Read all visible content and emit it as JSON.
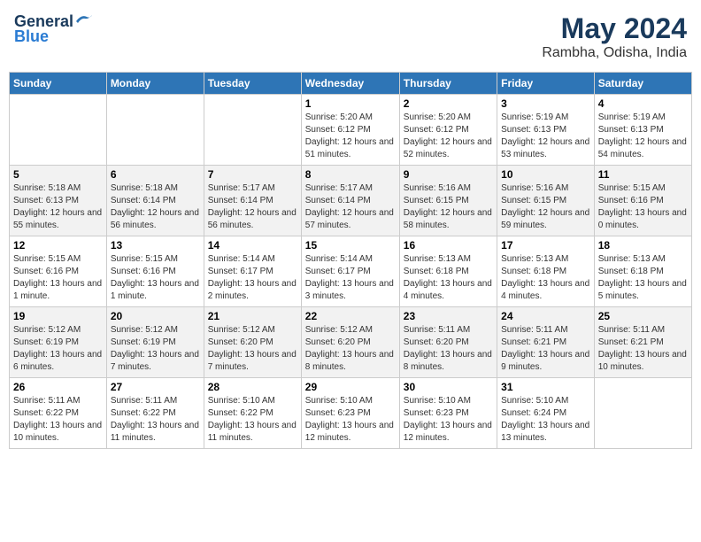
{
  "header": {
    "logo_general": "General",
    "logo_blue": "Blue",
    "month": "May 2024",
    "location": "Rambha, Odisha, India"
  },
  "days_of_week": [
    "Sunday",
    "Monday",
    "Tuesday",
    "Wednesday",
    "Thursday",
    "Friday",
    "Saturday"
  ],
  "weeks": [
    [
      {
        "day": "",
        "sunrise": "",
        "sunset": "",
        "daylight": ""
      },
      {
        "day": "",
        "sunrise": "",
        "sunset": "",
        "daylight": ""
      },
      {
        "day": "",
        "sunrise": "",
        "sunset": "",
        "daylight": ""
      },
      {
        "day": "1",
        "sunrise": "5:20 AM",
        "sunset": "6:12 PM",
        "daylight": "12 hours and 51 minutes."
      },
      {
        "day": "2",
        "sunrise": "5:20 AM",
        "sunset": "6:12 PM",
        "daylight": "12 hours and 52 minutes."
      },
      {
        "day": "3",
        "sunrise": "5:19 AM",
        "sunset": "6:13 PM",
        "daylight": "12 hours and 53 minutes."
      },
      {
        "day": "4",
        "sunrise": "5:19 AM",
        "sunset": "6:13 PM",
        "daylight": "12 hours and 54 minutes."
      }
    ],
    [
      {
        "day": "5",
        "sunrise": "5:18 AM",
        "sunset": "6:13 PM",
        "daylight": "12 hours and 55 minutes."
      },
      {
        "day": "6",
        "sunrise": "5:18 AM",
        "sunset": "6:14 PM",
        "daylight": "12 hours and 56 minutes."
      },
      {
        "day": "7",
        "sunrise": "5:17 AM",
        "sunset": "6:14 PM",
        "daylight": "12 hours and 56 minutes."
      },
      {
        "day": "8",
        "sunrise": "5:17 AM",
        "sunset": "6:14 PM",
        "daylight": "12 hours and 57 minutes."
      },
      {
        "day": "9",
        "sunrise": "5:16 AM",
        "sunset": "6:15 PM",
        "daylight": "12 hours and 58 minutes."
      },
      {
        "day": "10",
        "sunrise": "5:16 AM",
        "sunset": "6:15 PM",
        "daylight": "12 hours and 59 minutes."
      },
      {
        "day": "11",
        "sunrise": "5:15 AM",
        "sunset": "6:16 PM",
        "daylight": "13 hours and 0 minutes."
      }
    ],
    [
      {
        "day": "12",
        "sunrise": "5:15 AM",
        "sunset": "6:16 PM",
        "daylight": "13 hours and 1 minute."
      },
      {
        "day": "13",
        "sunrise": "5:15 AM",
        "sunset": "6:16 PM",
        "daylight": "13 hours and 1 minute."
      },
      {
        "day": "14",
        "sunrise": "5:14 AM",
        "sunset": "6:17 PM",
        "daylight": "13 hours and 2 minutes."
      },
      {
        "day": "15",
        "sunrise": "5:14 AM",
        "sunset": "6:17 PM",
        "daylight": "13 hours and 3 minutes."
      },
      {
        "day": "16",
        "sunrise": "5:13 AM",
        "sunset": "6:18 PM",
        "daylight": "13 hours and 4 minutes."
      },
      {
        "day": "17",
        "sunrise": "5:13 AM",
        "sunset": "6:18 PM",
        "daylight": "13 hours and 4 minutes."
      },
      {
        "day": "18",
        "sunrise": "5:13 AM",
        "sunset": "6:18 PM",
        "daylight": "13 hours and 5 minutes."
      }
    ],
    [
      {
        "day": "19",
        "sunrise": "5:12 AM",
        "sunset": "6:19 PM",
        "daylight": "13 hours and 6 minutes."
      },
      {
        "day": "20",
        "sunrise": "5:12 AM",
        "sunset": "6:19 PM",
        "daylight": "13 hours and 7 minutes."
      },
      {
        "day": "21",
        "sunrise": "5:12 AM",
        "sunset": "6:20 PM",
        "daylight": "13 hours and 7 minutes."
      },
      {
        "day": "22",
        "sunrise": "5:12 AM",
        "sunset": "6:20 PM",
        "daylight": "13 hours and 8 minutes."
      },
      {
        "day": "23",
        "sunrise": "5:11 AM",
        "sunset": "6:20 PM",
        "daylight": "13 hours and 8 minutes."
      },
      {
        "day": "24",
        "sunrise": "5:11 AM",
        "sunset": "6:21 PM",
        "daylight": "13 hours and 9 minutes."
      },
      {
        "day": "25",
        "sunrise": "5:11 AM",
        "sunset": "6:21 PM",
        "daylight": "13 hours and 10 minutes."
      }
    ],
    [
      {
        "day": "26",
        "sunrise": "5:11 AM",
        "sunset": "6:22 PM",
        "daylight": "13 hours and 10 minutes."
      },
      {
        "day": "27",
        "sunrise": "5:11 AM",
        "sunset": "6:22 PM",
        "daylight": "13 hours and 11 minutes."
      },
      {
        "day": "28",
        "sunrise": "5:10 AM",
        "sunset": "6:22 PM",
        "daylight": "13 hours and 11 minutes."
      },
      {
        "day": "29",
        "sunrise": "5:10 AM",
        "sunset": "6:23 PM",
        "daylight": "13 hours and 12 minutes."
      },
      {
        "day": "30",
        "sunrise": "5:10 AM",
        "sunset": "6:23 PM",
        "daylight": "13 hours and 12 minutes."
      },
      {
        "day": "31",
        "sunrise": "5:10 AM",
        "sunset": "6:24 PM",
        "daylight": "13 hours and 13 minutes."
      },
      {
        "day": "",
        "sunrise": "",
        "sunset": "",
        "daylight": ""
      }
    ]
  ]
}
